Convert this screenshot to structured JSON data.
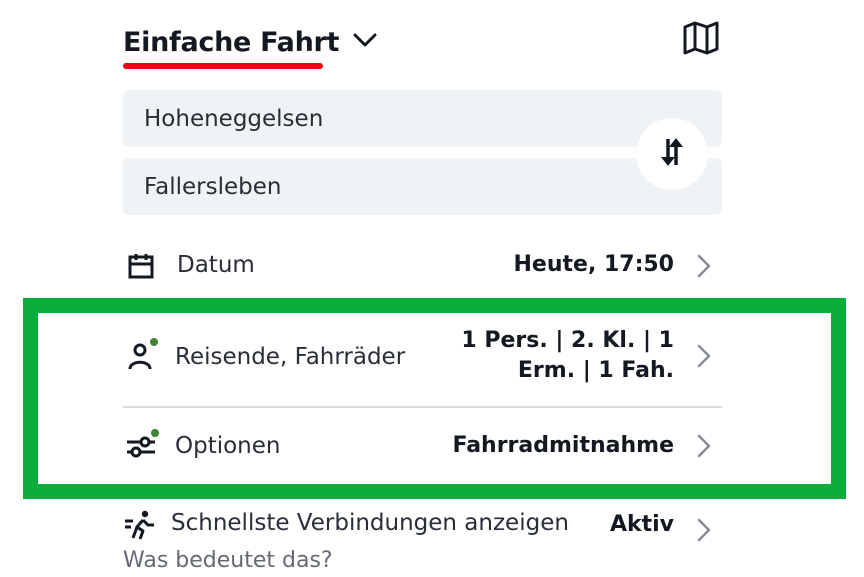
{
  "header": {
    "trip_type": "Einfache Fahrt",
    "map_icon": "map-icon",
    "accent_color": "#ec0016"
  },
  "stations": {
    "from": "Hoheneggelsen",
    "to": "Fallersleben",
    "swap_icon": "swap-arrows-icon"
  },
  "rows": {
    "date": {
      "icon": "calendar-icon",
      "label": "Datum",
      "value": "Heute, 17:50"
    },
    "travelers": {
      "icon": "person-icon",
      "label": "Reisende, Fahrräder",
      "value_line1": "1 Pers. | 2. Kl. | 1",
      "value_line2": "Erm. | 1 Fah."
    },
    "options": {
      "icon": "sliders-icon",
      "label": "Optionen",
      "value": "Fahrradmitnahme"
    },
    "fastest": {
      "icon": "walking-fast-icon",
      "label": "Schnellste Verbindungen anzeigen",
      "value": "Aktiv"
    }
  },
  "help_link": "Was bedeutet das?",
  "colors": {
    "highlight": "#0bae3d",
    "status_dot": "#408335",
    "field_bg": "#f0f3f5"
  }
}
